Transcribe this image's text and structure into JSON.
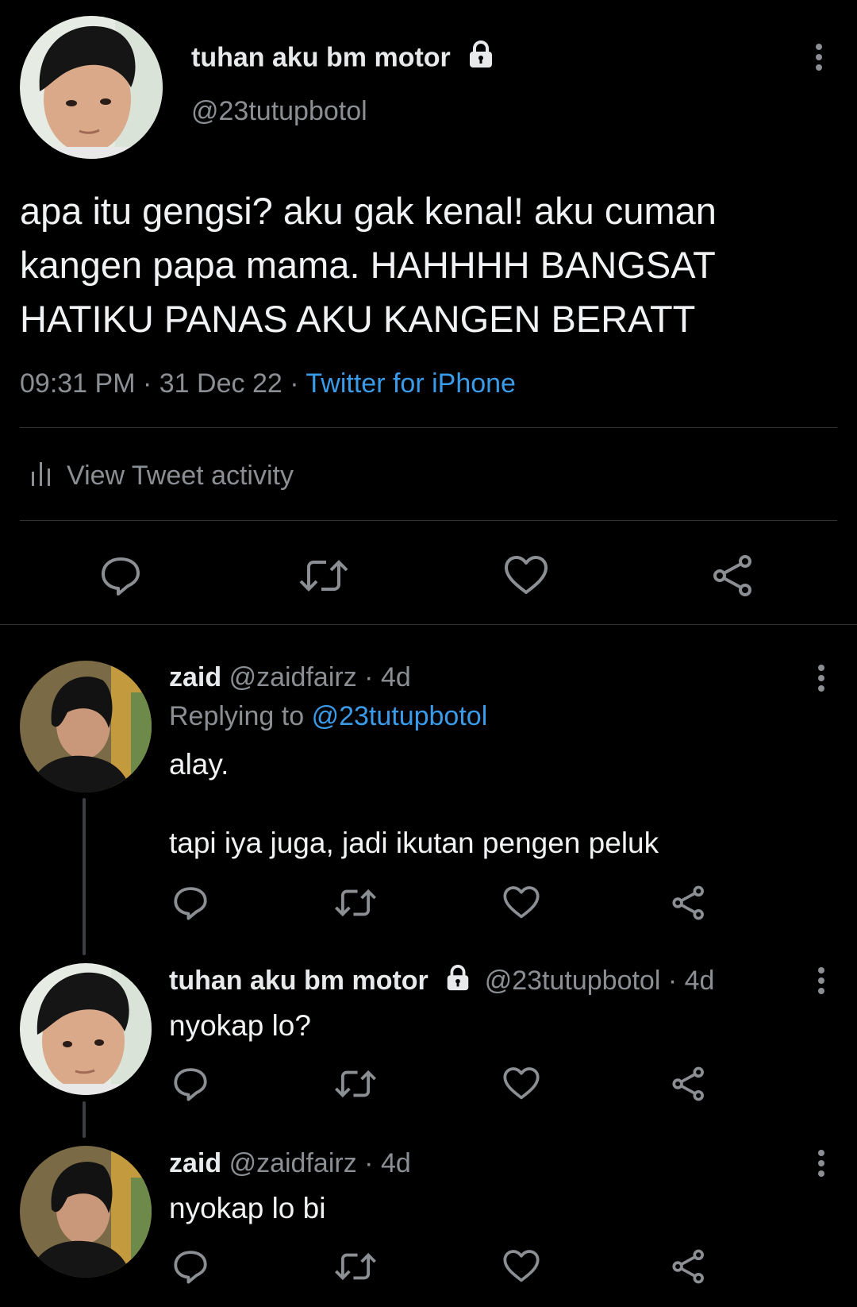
{
  "main_tweet": {
    "display_name": "tuhan aku bm motor",
    "handle": "@23tutupbotol",
    "text_lines": [
      "apa itu gengsi? aku gak kenal! aku cuman",
      "kangen papa mama. HAHHHH BANGSAT",
      "HATIKU PANAS AKU KANGEN BERATT"
    ],
    "time": "09:31 PM",
    "date": "31 Dec 22",
    "source": "Twitter for iPhone",
    "activity_label": "View Tweet activity"
  },
  "replies": [
    {
      "display_name": "zaid",
      "handle": "@zaidfairz",
      "age": "4d",
      "replying_prefix": "Replying to",
      "replying_to": "@23tutupbotol",
      "text_line1": "alay.",
      "text_line2": "tapi iya juga, jadi ikutan pengen peluk"
    },
    {
      "display_name": "tuhan aku bm motor",
      "handle": "@23tutupbotol",
      "age": "4d",
      "text": "nyokap lo?"
    },
    {
      "display_name": "zaid",
      "handle": "@zaidfairz",
      "age": "4d",
      "text": "nyokap lo bi"
    }
  ],
  "separator": "·",
  "colors": {
    "background": "#000000",
    "text": "#e7e9ea",
    "muted": "#8b8f94",
    "link": "#3a9be8",
    "divider": "#2f3336"
  },
  "icons": [
    "lock-icon",
    "more-icon",
    "reply-icon",
    "retweet-icon",
    "like-icon",
    "share-icon",
    "bar-chart-icon"
  ]
}
